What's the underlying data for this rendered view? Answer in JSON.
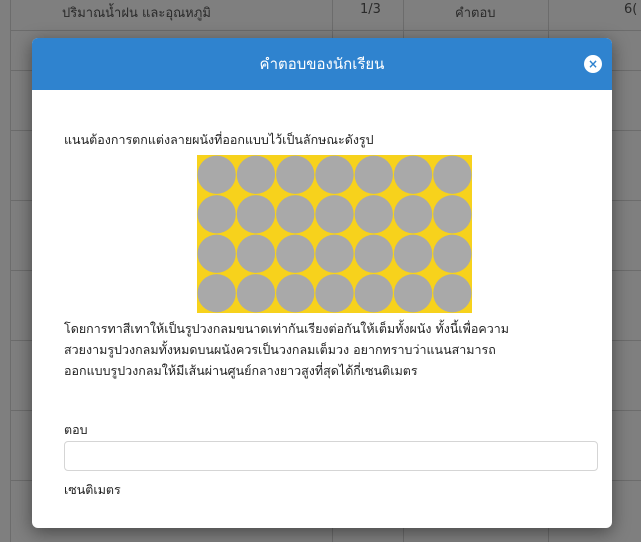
{
  "background": {
    "row_text": "ปริมาณน้ำฝน และอุณหภูมิ",
    "fraction": "1/3",
    "answer_col": "คำตอบ",
    "edge_text": "6("
  },
  "modal": {
    "title": "คำตอบของนักเรียน",
    "close_label": "×",
    "header_color": "#2f83cf"
  },
  "question": {
    "intro": "แนนต้องการตกแต่งลายผนังที่ออกแบบไว้เป็นลักษณะดังรูป",
    "body_lines": [
      "โดยการทาสีเทาให้เป็นรูปวงกลมขนาดเท่ากันเรียงต่อกันให้เต็มทั้งผนัง ทั้งนี้เพื่อความ",
      "สวยงามรูปวงกลมทั้งหมดบนผนังควรเป็นวงกลมเต็มวง อยากทราบว่าแนนสามารถ",
      "ออกแบบรูปวงกลมให้มีเส้นผ่านศูนย์กลางยาวสูงที่สุดได้กี่เซนติเมตร"
    ],
    "pattern": {
      "rows": 4,
      "cols": 7,
      "background_color": "#f7d21c",
      "circle_color": "#a9a9a9"
    }
  },
  "answer": {
    "label": "ตอบ",
    "value": "",
    "placeholder": "",
    "unit": "เซนติเมตร"
  }
}
